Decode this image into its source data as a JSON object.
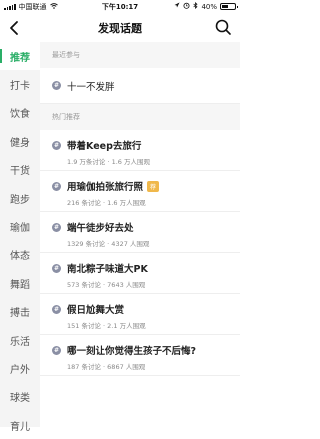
{
  "status_bar": {
    "carrier": "中国联通",
    "time": "下午10:17",
    "battery": "40%"
  },
  "header": {
    "title": "发现话题"
  },
  "sidebar": {
    "items": [
      {
        "label": "推荐",
        "active": true
      },
      {
        "label": "打卡"
      },
      {
        "label": "饮食"
      },
      {
        "label": "健身"
      },
      {
        "label": "干货"
      },
      {
        "label": "跑步"
      },
      {
        "label": "瑜伽"
      },
      {
        "label": "体态"
      },
      {
        "label": "舞蹈"
      },
      {
        "label": "搏击"
      },
      {
        "label": "乐活"
      },
      {
        "label": "户外"
      },
      {
        "label": "球类"
      },
      {
        "label": "育儿"
      }
    ]
  },
  "recent": {
    "label": "最近参与",
    "topics": [
      {
        "name": "十一不发胖"
      }
    ]
  },
  "hot": {
    "label": "热门推荐",
    "topics": [
      {
        "name": "带着Keep去旅行",
        "meta": "1.9 万条讨论 · 1.6 万人围观"
      },
      {
        "name": "用瑜伽拍张旅行照",
        "meta": "216 条讨论 · 1.6 万人围观",
        "badge": "荐"
      },
      {
        "name": "端午徒步好去处",
        "meta": "1329 条讨论 · 4327 人围观"
      },
      {
        "name": "南北粽子味道大PK",
        "meta": "573 条讨论 · 7643 人围观"
      },
      {
        "name": "假日尬舞大赏",
        "meta": "151 条讨论 · 2.1 万人围观"
      },
      {
        "name": "哪一刻让你觉得生孩子不后悔?",
        "meta": "187 条讨论 · 6867 人围观"
      }
    ]
  }
}
